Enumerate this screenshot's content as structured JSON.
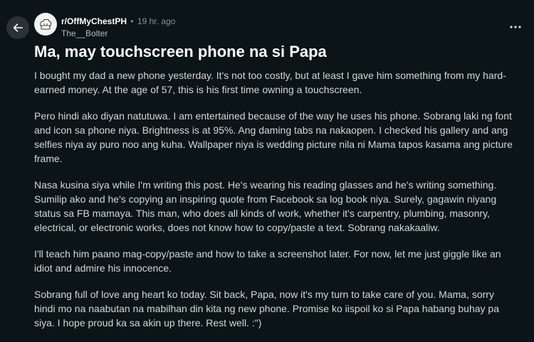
{
  "post": {
    "subreddit": "r/OffMyChestPH",
    "separator": "•",
    "time_ago": "19 hr. ago",
    "author": "The__Bolter",
    "title": "Ma, may touchscreen phone na si Papa",
    "paragraphs": [
      "I bought my dad a new phone yesterday. It's not too costly, but at least I gave him something from my hard-earned money. At the age of 57, this is his first time owning a touchscreen.",
      "Pero hindi ako diyan natutuwa. I am entertained because of the way he uses his phone. Sobrang laki ng font and icon sa phone niya. Brightness is at 95%. Ang daming tabs na nakaopen. I checked his gallery and ang selfies niya ay puro noo ang kuha. Wallpaper niya is wedding picture nila ni Mama tapos kasama ang picture frame.",
      "Nasa kusina siya while I'm writing this post. He's wearing his reading glasses and he's writing something. Sumilip ako and he's copying an inspiring quote from Facebook sa log book niya. Surely, gagawin niyang status sa FB mamaya. This man, who does all kinds of work, whether it's carpentry, plumbing, masonry, electrical, or electronic works, does not know how to copy/paste a text. Sobrang nakakaaliw.",
      "I'll teach him paano mag-copy/paste and how to take a screenshot later. For now, let me just giggle like an idiot and admire his innocence.",
      "Sobrang full of love ang heart ko today. Sit back, Papa, now it's my turn to take care of you. Mama, sorry hindi mo na naabutan na mabilhan din kita ng new phone. Promise ko iispoil ko si Papa habang buhay pa siya. I hope proud ka sa akin up there. Rest well. :\")"
    ]
  },
  "icons": {
    "back": "arrow-left-icon",
    "avatar": "subreddit-avatar-icon",
    "more": "more-horizontal-icon"
  },
  "colors": {
    "background": "#0b1416",
    "title": "#ffffff",
    "body_text": "#d2d7da",
    "meta_text": "#8a9296",
    "back_button_bg": "#2a3236"
  }
}
